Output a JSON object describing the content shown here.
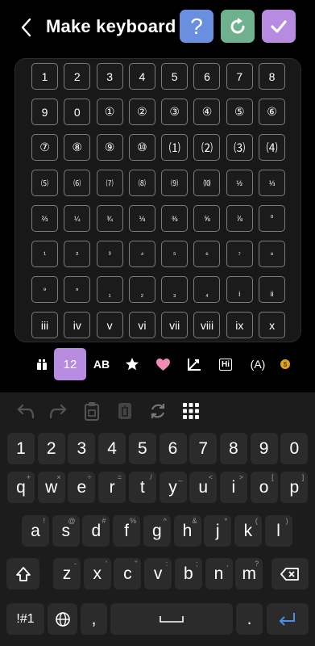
{
  "header": {
    "title": "Make keyboard",
    "help_label": "?"
  },
  "grid": {
    "keys": [
      "1",
      "2",
      "3",
      "4",
      "5",
      "6",
      "7",
      "8",
      "9",
      "0",
      "①",
      "②",
      "③",
      "④",
      "⑤",
      "⑥",
      "⑦",
      "⑧",
      "⑨",
      "⑩",
      "⑴",
      "⑵",
      "⑶",
      "⑷",
      "⑸",
      "⑹",
      "⑺",
      "⑻",
      "⑼",
      "⑽",
      "½",
      "⅓",
      "⅔",
      "¼",
      "¾",
      "⅛",
      "⅜",
      "⅝",
      "⅞",
      "⁰",
      "¹",
      "²",
      "³",
      "⁴",
      "⁵",
      "⁶",
      "⁷",
      "⁸",
      "⁹",
      "ⁿ",
      "₁",
      "₂",
      "₃",
      "₄",
      "i",
      "ii",
      "iii",
      "iv",
      "v",
      "vi",
      "vii",
      "viii",
      "ix",
      "x"
    ]
  },
  "categories": {
    "active_label": "12",
    "ab_label": "AB",
    "hi_label": "Hi",
    "paren_a_label": "(A)"
  },
  "keyboard": {
    "numbers": [
      "1",
      "2",
      "3",
      "4",
      "5",
      "6",
      "7",
      "8",
      "9",
      "0"
    ],
    "row1": [
      "q",
      "w",
      "e",
      "r",
      "t",
      "y",
      "u",
      "i",
      "o",
      "p"
    ],
    "row1_sup": [
      "+",
      "×",
      "÷",
      "=",
      "/",
      "_",
      "<",
      ">",
      "[",
      "]"
    ],
    "row2": [
      "a",
      "s",
      "d",
      "f",
      "g",
      "h",
      "j",
      "k",
      "l"
    ],
    "row2_sup": [
      "!",
      "@",
      "#",
      "%",
      "^",
      "&",
      "*",
      "(",
      ")"
    ],
    "row3": [
      "z",
      "x",
      "c",
      "v",
      "b",
      "n",
      "m"
    ],
    "row3_sup": [
      "-",
      "'",
      "\"",
      ":",
      ";",
      ",",
      "?"
    ],
    "sym_label": "!#1",
    "comma_label": ",",
    "period_label": "."
  }
}
